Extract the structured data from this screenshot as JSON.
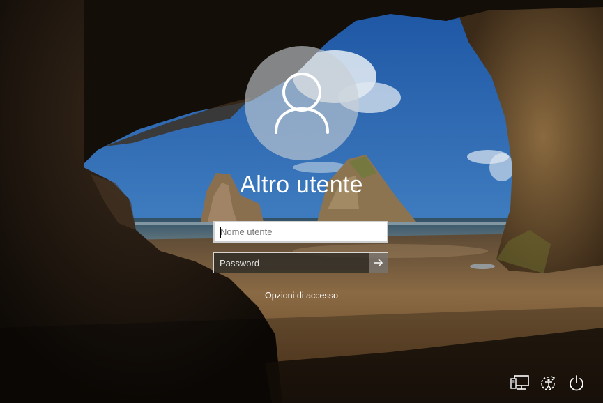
{
  "user": {
    "display_name": "Altro utente",
    "avatar_icon": "user-silhouette-icon"
  },
  "form": {
    "username_placeholder": "Nome utente",
    "username_value": "",
    "password_placeholder": "Password",
    "password_value": "",
    "submit_icon": "arrow-right-icon"
  },
  "links": {
    "signin_options": "Opzioni di accesso"
  },
  "corner_buttons": {
    "network_icon": "network-icon",
    "accessibility_icon": "ease-of-access-icon",
    "power_icon": "power-icon"
  },
  "colors": {
    "sky": "#3a74b6",
    "sand": "#8a6238",
    "cave": "#0d0a07",
    "text": "#ffffff"
  }
}
